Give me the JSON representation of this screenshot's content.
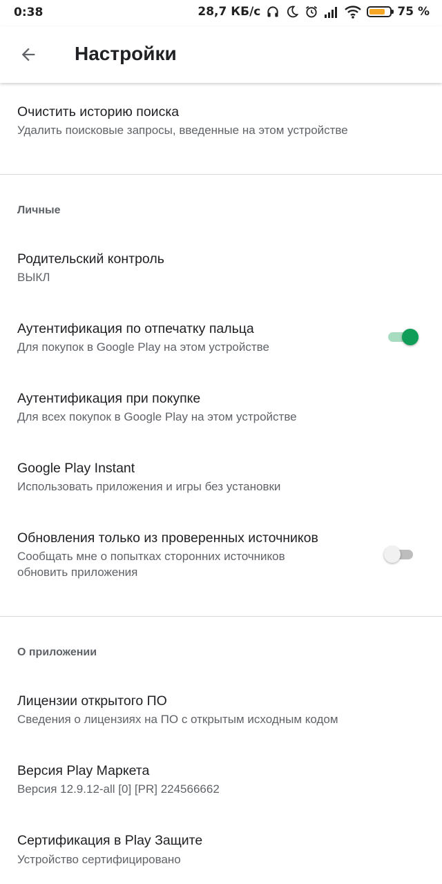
{
  "status_bar": {
    "time": "0:38",
    "network_speed": "28,7 КБ/с",
    "icons": [
      "headphones-icon",
      "moon-icon",
      "alarm-icon",
      "signal-icon",
      "wifi-icon",
      "battery-icon"
    ],
    "battery_percent": "75 %",
    "battery_level": 0.75,
    "battery_color": "#f5a623"
  },
  "appbar": {
    "back_icon": "arrow-back-icon",
    "title": "Настройки"
  },
  "general": {
    "clear_history": {
      "title": "Очистить историю поиска",
      "subtitle": "Удалить поисковые запросы, введенные на этом устройстве"
    }
  },
  "personal": {
    "header": "Личные",
    "parental": {
      "title": "Родительский контроль",
      "subtitle": "ВЫКЛ"
    },
    "fingerprint": {
      "title": "Аутентификация по отпечатку пальца",
      "subtitle": "Для покупок в Google Play на этом устройстве",
      "enabled": true
    },
    "purchase_auth": {
      "title": "Аутентификация при покупке",
      "subtitle": "Для всех покупок в Google Play на этом устройстве"
    },
    "instant": {
      "title": "Google Play Instant",
      "subtitle": "Использовать приложения и игры без установки"
    },
    "verified_updates": {
      "title": "Обновления только из проверенных источников",
      "subtitle_line1": "Сообщать мне о попытках сторонних источников",
      "subtitle_line2": "обновить приложения",
      "enabled": false
    }
  },
  "about": {
    "header": "О приложении",
    "licenses": {
      "title": "Лицензии открытого ПО",
      "subtitle": "Сведения о лицензиях на ПО с открытым исходным кодом"
    },
    "version": {
      "title": "Версия Play Маркета",
      "subtitle": "Версия 12.9.12-all [0] [PR] 224566662"
    },
    "certification": {
      "title": "Сертификация в Play Защите",
      "subtitle": "Устройство сертифицировано"
    }
  },
  "colors": {
    "accent": "#0f9d58",
    "accent_track": "#a8dcc0",
    "text_primary": "#202124",
    "text_secondary": "#5f6368"
  }
}
